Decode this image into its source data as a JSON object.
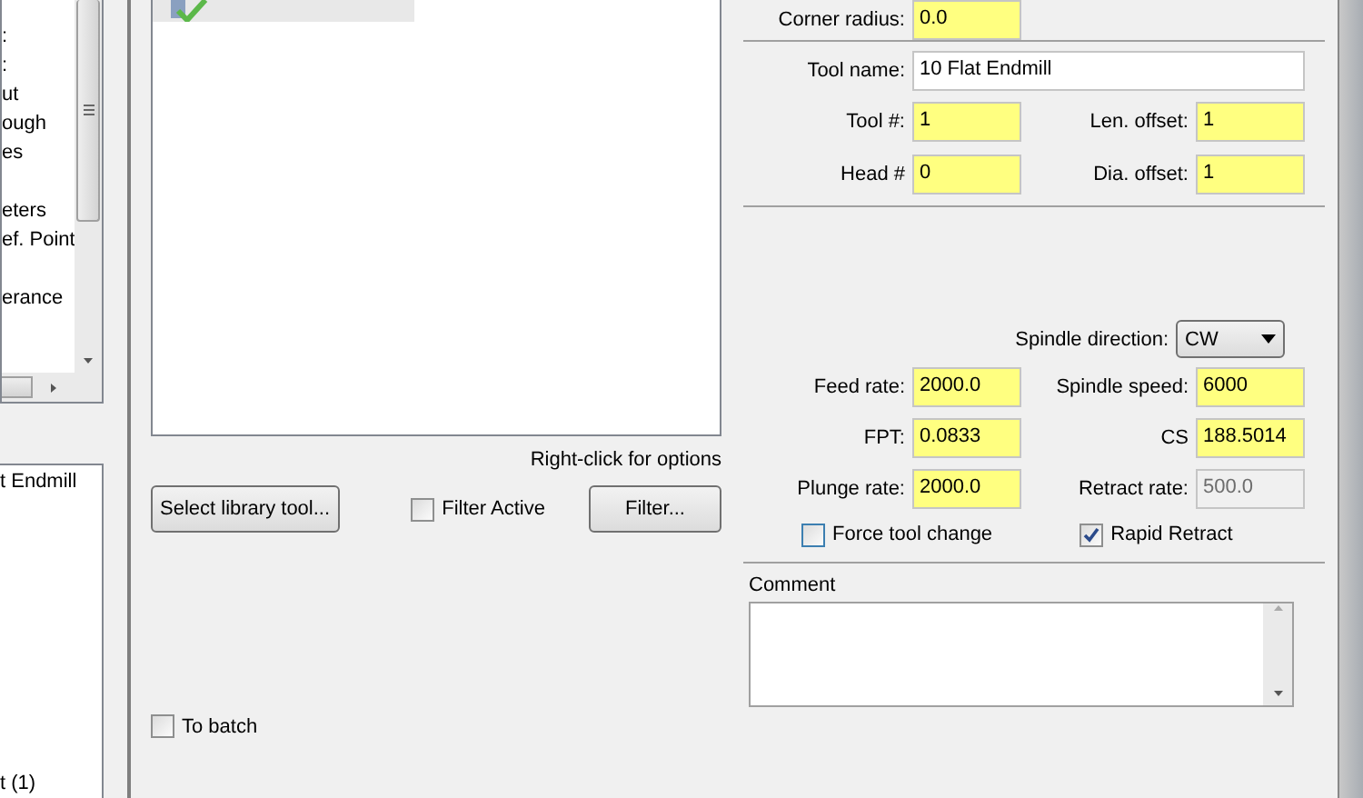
{
  "tree": {
    "items": [
      {
        "label": ":",
        "gap_before": false
      },
      {
        "label": ":",
        "gap_before": false
      },
      {
        "label": "ut",
        "gap_before": false
      },
      {
        "label": "ough",
        "gap_before": false
      },
      {
        "label": "es",
        "gap_before": false
      },
      {
        "label": "eters",
        "gap_before": true
      },
      {
        "label": "ef. Point",
        "gap_before": false
      },
      {
        "label": "erance",
        "gap_before": true
      }
    ]
  },
  "op_list": {
    "items": [
      {
        "label": "t Endmill"
      },
      {
        "label": "t (1)"
      }
    ]
  },
  "tool_list": {
    "rows": [
      {
        "selected": true
      }
    ],
    "hint": "Right-click for options"
  },
  "library_button": "Select library tool...",
  "filter_active": {
    "label": "Filter Active",
    "checked": false
  },
  "filter_button": "Filter...",
  "to_batch": {
    "label": "To batch",
    "checked": false
  },
  "corner_radius": {
    "label": "Corner radius:",
    "value": "0.0"
  },
  "tool_name": {
    "label": "Tool name:",
    "value": "10 Flat Endmill"
  },
  "ids": [
    {
      "left_label": "Tool #:",
      "left_value": "1",
      "right_label": "Len. offset:",
      "right_value": "1"
    },
    {
      "left_label": "Head #",
      "left_value": "0",
      "right_label": "Dia. offset:",
      "right_value": "1"
    }
  ],
  "spindle_direction": {
    "label": "Spindle direction:",
    "value": "CW"
  },
  "feeds": [
    {
      "left_label": "Feed rate:",
      "left_value": "2000.0",
      "right_label": "Spindle speed:",
      "right_value": "6000",
      "right_disabled": false
    },
    {
      "left_label": "FPT:",
      "left_value": "0.0833",
      "right_label": "CS",
      "right_value": "188.5014",
      "right_disabled": false
    },
    {
      "left_label": "Plunge rate:",
      "left_value": "2000.0",
      "right_label": "Retract rate:",
      "right_value": "500.0",
      "right_disabled": true
    }
  ],
  "force_tool_change": {
    "label": "Force tool change",
    "checked": false
  },
  "rapid_retract": {
    "label": "Rapid Retract",
    "checked": true
  },
  "comment": {
    "label": "Comment"
  }
}
